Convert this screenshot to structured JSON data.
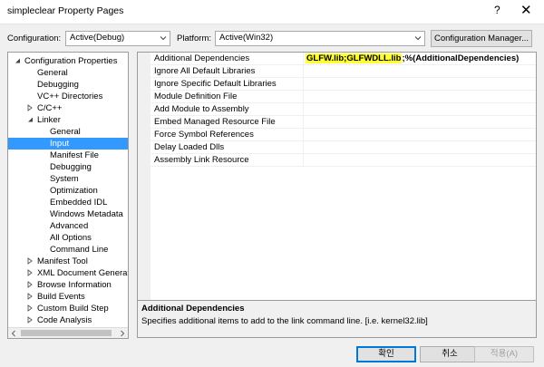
{
  "window": {
    "title": "simpleclear Property Pages",
    "help_label": "?",
    "close_label": "✕"
  },
  "top": {
    "configuration_label": "Configuration:",
    "configuration_value": "Active(Debug)",
    "platform_label": "Platform:",
    "platform_value": "Active(Win32)",
    "config_manager_label": "Configuration Manager..."
  },
  "tree": {
    "items": [
      {
        "label": "Configuration Properties",
        "expander": "expanded"
      },
      {
        "label": "General",
        "expander": "none"
      },
      {
        "label": "Debugging",
        "expander": "none"
      },
      {
        "label": "VC++ Directories",
        "expander": "none"
      },
      {
        "label": "C/C++",
        "expander": "collapsed"
      },
      {
        "label": "Linker",
        "expander": "expanded"
      },
      {
        "label": "General",
        "expander": "none"
      },
      {
        "label": "Input",
        "expander": "none"
      },
      {
        "label": "Manifest File",
        "expander": "none"
      },
      {
        "label": "Debugging",
        "expander": "none"
      },
      {
        "label": "System",
        "expander": "none"
      },
      {
        "label": "Optimization",
        "expander": "none"
      },
      {
        "label": "Embedded IDL",
        "expander": "none"
      },
      {
        "label": "Windows Metadata",
        "expander": "none"
      },
      {
        "label": "Advanced",
        "expander": "none"
      },
      {
        "label": "All Options",
        "expander": "none"
      },
      {
        "label": "Command Line",
        "expander": "none"
      },
      {
        "label": "Manifest Tool",
        "expander": "collapsed"
      },
      {
        "label": "XML Document Generator",
        "expander": "collapsed"
      },
      {
        "label": "Browse Information",
        "expander": "collapsed"
      },
      {
        "label": "Build Events",
        "expander": "collapsed"
      },
      {
        "label": "Custom Build Step",
        "expander": "collapsed"
      },
      {
        "label": "Code Analysis",
        "expander": "collapsed"
      }
    ]
  },
  "grid": {
    "rows": [
      {
        "name": "Additional Dependencies",
        "value_highlight": "GLFW.lib;GLFWDLL.lib",
        "value_rest": ";%(AdditionalDependencies)"
      },
      {
        "name": "Ignore All Default Libraries"
      },
      {
        "name": "Ignore Specific Default Libraries"
      },
      {
        "name": "Module Definition File"
      },
      {
        "name": "Add Module to Assembly"
      },
      {
        "name": "Embed Managed Resource File"
      },
      {
        "name": "Force Symbol References"
      },
      {
        "name": "Delay Loaded Dlls"
      },
      {
        "name": "Assembly Link Resource"
      }
    ]
  },
  "description": {
    "title": "Additional Dependencies",
    "text": "Specifies additional items to add to the link command line. [i.e. kernel32.lib]"
  },
  "buttons": {
    "ok": "확인",
    "cancel": "취소",
    "apply": "적용(A)"
  },
  "colors": {
    "selection": "#3399ff",
    "highlight": "#ffff33",
    "dialog_bg": "#f0f0f0"
  }
}
